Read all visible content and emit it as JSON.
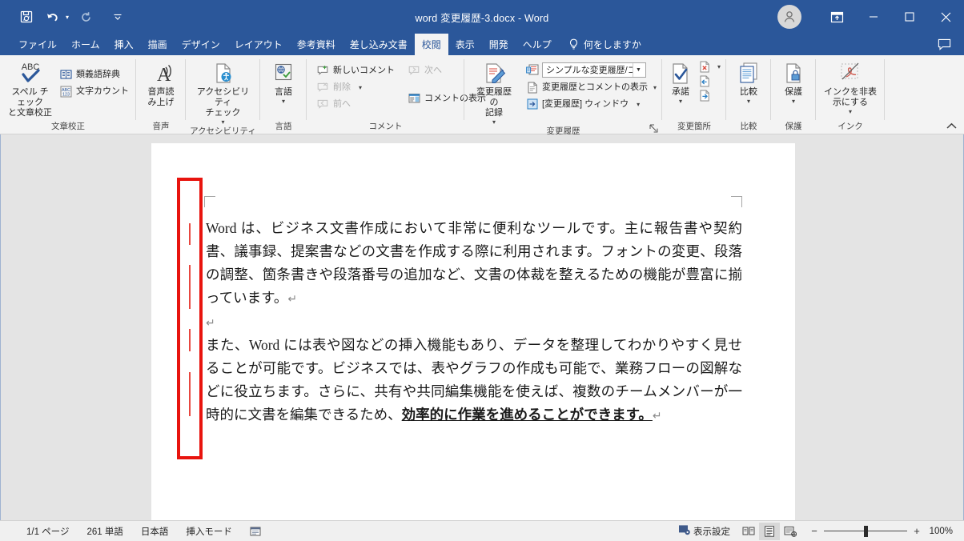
{
  "window": {
    "title": "word 変更履歴-3.docx  -  Word",
    "accent_color": "#2b579a",
    "controls": {
      "ribbon_display_options": "リボンの表示オプション",
      "minimize": "最小化",
      "maximize": "最大化",
      "close": "閉じる",
      "account": "アカウント"
    }
  },
  "quick_access": {
    "save": "上書き保存",
    "undo": "元に戻す",
    "undo_more": "元に戻す履歴",
    "redo": "やり直し",
    "customize": "クイック アクセス ツール バーのユーザー設定"
  },
  "tabs": [
    {
      "label": "ファイル",
      "active": false
    },
    {
      "label": "ホーム",
      "active": false
    },
    {
      "label": "挿入",
      "active": false
    },
    {
      "label": "描画",
      "active": false
    },
    {
      "label": "デザイン",
      "active": false
    },
    {
      "label": "レイアウト",
      "active": false
    },
    {
      "label": "参考資料",
      "active": false
    },
    {
      "label": "差し込み文書",
      "active": false
    },
    {
      "label": "校閲",
      "active": true
    },
    {
      "label": "表示",
      "active": false
    },
    {
      "label": "開発",
      "active": false
    },
    {
      "label": "ヘルプ",
      "active": false
    }
  ],
  "tell_me": {
    "label": "何をしますか",
    "icon": "lightbulb-icon"
  },
  "ribbon": {
    "collapse_label": "リボンを折りたたむ",
    "groups": [
      {
        "name": "proofing",
        "label": "文章校正",
        "big_buttons": [
          {
            "id": "spelling",
            "label": "スペル チェック\nと文章校正",
            "icon": "abc-check-icon"
          }
        ],
        "small_buttons": [
          {
            "id": "thesaurus",
            "label": "類義語辞典",
            "icon": "thesaurus-icon",
            "disabled": false
          },
          {
            "id": "word-count",
            "label": "文字カウント",
            "icon": "word-count-icon",
            "disabled": false
          }
        ]
      },
      {
        "name": "speech",
        "label": "音声",
        "big_buttons": [
          {
            "id": "read-aloud",
            "label": "音声読\nみ上げ",
            "icon": "read-aloud-icon"
          }
        ],
        "small_buttons": []
      },
      {
        "name": "accessibility",
        "label": "アクセシビリティ",
        "big_buttons": [
          {
            "id": "check-accessibility",
            "label": "アクセシビリティ\nチェック",
            "icon": "accessibility-icon",
            "has_caret": true
          }
        ],
        "small_buttons": []
      },
      {
        "name": "language",
        "label": "言語",
        "big_buttons": [
          {
            "id": "language",
            "label": "言語",
            "icon": "language-icon",
            "has_caret": true
          }
        ],
        "small_buttons": []
      },
      {
        "name": "comments",
        "label": "コメント",
        "big_buttons": [],
        "small_buttons": [
          {
            "id": "new-comment",
            "label": "新しいコメント",
            "icon": "new-comment-icon",
            "disabled": false
          },
          {
            "id": "delete-comment",
            "label": "削除",
            "icon": "delete-comment-icon",
            "disabled": true,
            "has_caret": true
          },
          {
            "id": "previous-comment",
            "label": "前へ",
            "icon": "previous-comment-icon",
            "disabled": true
          },
          {
            "id": "next-comment",
            "label": "次へ",
            "icon": "next-comment-icon",
            "disabled": true
          },
          {
            "id": "show-comments",
            "label": "コメントの表示",
            "icon": "show-comments-icon",
            "disabled": false
          }
        ]
      },
      {
        "name": "tracking",
        "label": "変更履歴",
        "big_buttons": [
          {
            "id": "track-changes",
            "label": "変更履歴の\n記録",
            "icon": "track-changes-icon",
            "has_caret": true
          }
        ],
        "dropdown": {
          "id": "display-for-review",
          "value": "シンプルな変更履歴/コ…",
          "icon": "display-review-icon"
        },
        "small_buttons": [
          {
            "id": "show-markup",
            "label": "変更履歴とコメントの表示",
            "icon": "show-markup-icon",
            "has_caret": true
          },
          {
            "id": "reviewing-pane",
            "label": "[変更履歴] ウィンドウ",
            "icon": "reviewing-pane-icon",
            "has_caret": true
          }
        ],
        "has_dialog_launcher": true
      },
      {
        "name": "changes",
        "label": "変更箇所",
        "big_buttons": [
          {
            "id": "accept",
            "label": "承諾",
            "icon": "accept-icon",
            "has_caret": true
          }
        ],
        "small_buttons": [
          {
            "id": "reject",
            "label": "",
            "icon": "reject-icon",
            "has_caret": true
          },
          {
            "id": "previous-change",
            "label": "",
            "icon": "previous-change-icon"
          },
          {
            "id": "next-change",
            "label": "",
            "icon": "next-change-icon"
          }
        ]
      },
      {
        "name": "compare",
        "label": "比較",
        "big_buttons": [
          {
            "id": "compare",
            "label": "比較",
            "icon": "compare-icon",
            "has_caret": true
          }
        ],
        "small_buttons": []
      },
      {
        "name": "protect",
        "label": "保護",
        "big_buttons": [
          {
            "id": "protect",
            "label": "保護",
            "icon": "protect-icon",
            "has_caret": true
          }
        ],
        "small_buttons": []
      },
      {
        "name": "ink",
        "label": "インク",
        "big_buttons": [
          {
            "id": "hide-ink",
            "label": "インクを非表\n示にする",
            "icon": "hide-ink-icon",
            "has_caret": true
          }
        ],
        "small_buttons": []
      }
    ]
  },
  "document": {
    "paragraphs": [
      {
        "id": "p1",
        "runs": [
          {
            "text": "Word は、ビジネス文書作成において非常に便利なツールです。主に報告書や契約書、議事録、提案書などの文書を作成する際に利用されます。フォントの変更、段落の調整、箇条書きや段落番号の追加など、文書の体裁を整えるための機能が豊富に揃っています。",
            "bold": false,
            "underline": false
          }
        ],
        "mark": "↵"
      },
      {
        "id": "p-empty",
        "runs": [],
        "mark": "↵"
      },
      {
        "id": "p2",
        "runs": [
          {
            "text": "また、Word には表や図などの挿入機能もあり、データを整理してわかりやすく見せることが可能です。ビジネスでは、表やグラフの作成も可能で、業務フローの図解などに役立ちます。さらに、共有や共同編集機能を使えば、複数のチームメンバーが一時的に文書を編集できるため、",
            "bold": false,
            "underline": false
          },
          {
            "text": "効率的に作業を進めることができます。",
            "bold": true,
            "underline": true
          }
        ],
        "mark": "↵"
      }
    ],
    "change_bars_color": "#e8473f",
    "annotation_rect_color": "#e8140e"
  },
  "status_bar": {
    "page": "1/1 ページ",
    "words": "261 単語",
    "language": "日本語",
    "mode": "挿入モード",
    "track_icon": "track-changes-status-icon",
    "view_settings": "表示設定",
    "views": [
      {
        "id": "read-mode",
        "label": "閲覧モード",
        "selected": false
      },
      {
        "id": "print-layout",
        "label": "印刷レイアウト",
        "selected": true
      },
      {
        "id": "web-layout",
        "label": "Web レイアウト",
        "selected": false
      }
    ],
    "zoom_out": "−",
    "zoom_in": "+",
    "zoom_level": "100%"
  }
}
